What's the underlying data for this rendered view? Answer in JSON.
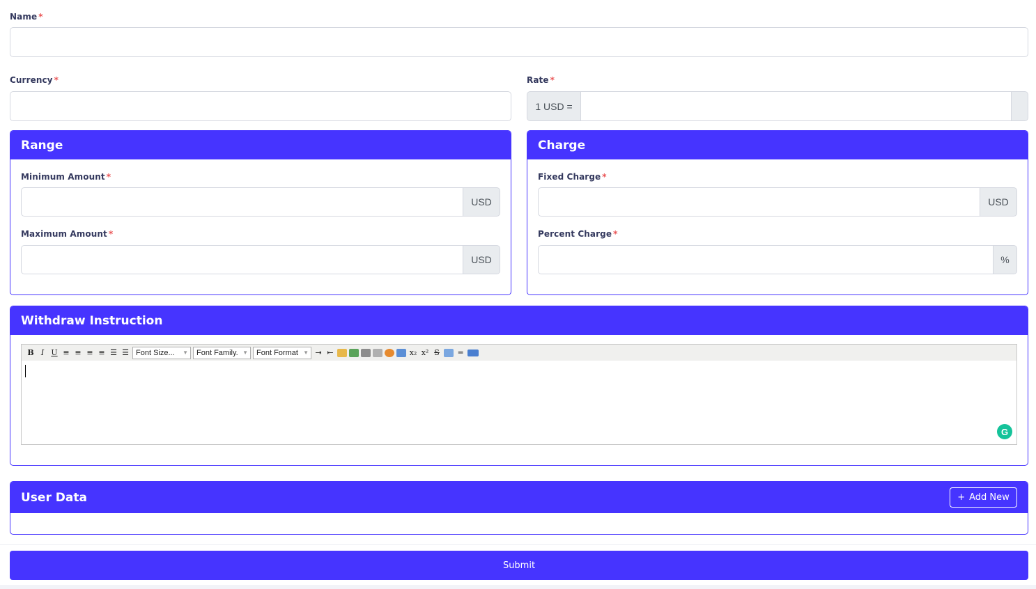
{
  "form": {
    "name": {
      "label": "Name",
      "required": "*",
      "value": ""
    },
    "currency": {
      "label": "Currency",
      "required": "*",
      "value": ""
    },
    "rate": {
      "label": "Rate",
      "required": "*",
      "prefix": "1 USD =",
      "value": ""
    }
  },
  "range": {
    "title": "Range",
    "minimum": {
      "label": "Minimum Amount",
      "required": "*",
      "suffix": "USD",
      "value": ""
    },
    "maximum": {
      "label": "Maximum Amount",
      "required": "*",
      "suffix": "USD",
      "value": ""
    }
  },
  "charge": {
    "title": "Charge",
    "fixed": {
      "label": "Fixed Charge",
      "required": "*",
      "suffix": "USD",
      "value": ""
    },
    "percent": {
      "label": "Percent Charge",
      "required": "*",
      "suffix": "%",
      "value": ""
    }
  },
  "instruction": {
    "title": "Withdraw Instruction",
    "toolbar": {
      "bold": "B",
      "italic": "I",
      "underline": "U",
      "font_size": "Font Size...",
      "font_family": "Font Family.",
      "font_format": "Font Format",
      "subscript": "x₂",
      "superscript": "x²",
      "strike": "S"
    },
    "grammarly": "G"
  },
  "user_data": {
    "title": "User Data",
    "add_label": "Add New",
    "add_icon": "+"
  },
  "submit_label": "Submit",
  "colors": {
    "primary": "#4634ff",
    "required": "#ea5455",
    "grammarly": "#15c39a"
  }
}
